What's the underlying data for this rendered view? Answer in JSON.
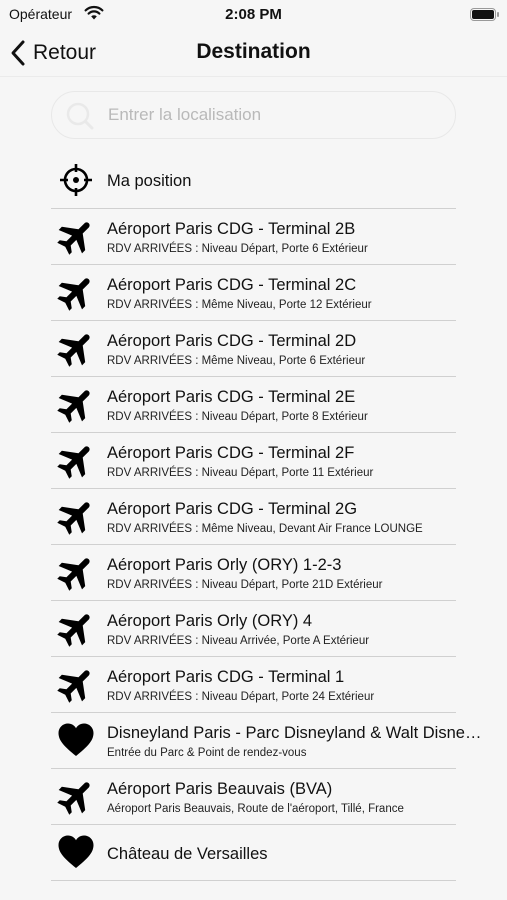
{
  "status_bar": {
    "carrier": "Opérateur",
    "time": "2:08 PM"
  },
  "nav": {
    "back_label": "Retour",
    "title": "Destination"
  },
  "search": {
    "placeholder": "Entrer la localisation"
  },
  "current_position": {
    "label": "Ma position",
    "icon": "crosshair-icon"
  },
  "destinations": [
    {
      "icon": "airplane-icon",
      "title": "Aéroport Paris CDG - Terminal 2B",
      "subtitle": "RDV ARRIVÉES : Niveau Départ, Porte 6 Extérieur"
    },
    {
      "icon": "airplane-icon",
      "title": "Aéroport Paris CDG - Terminal 2C",
      "subtitle": "RDV ARRIVÉES : Même Niveau, Porte 12 Extérieur"
    },
    {
      "icon": "airplane-icon",
      "title": "Aéroport Paris CDG - Terminal 2D",
      "subtitle": "RDV ARRIVÉES : Même Niveau, Porte 6 Extérieur"
    },
    {
      "icon": "airplane-icon",
      "title": "Aéroport Paris CDG - Terminal 2E",
      "subtitle": "RDV ARRIVÉES : Niveau Départ, Porte 8 Extérieur"
    },
    {
      "icon": "airplane-icon",
      "title": "Aéroport Paris CDG - Terminal 2F",
      "subtitle": "RDV ARRIVÉES : Niveau Départ, Porte 11 Extérieur"
    },
    {
      "icon": "airplane-icon",
      "title": "Aéroport Paris CDG - Terminal 2G",
      "subtitle": "RDV ARRIVÉES : Même Niveau, Devant Air France LOUNGE"
    },
    {
      "icon": "airplane-icon",
      "title": "Aéroport Paris Orly (ORY) 1-2-3",
      "subtitle": "RDV ARRIVÉES : Niveau Départ, Porte 21D Extérieur"
    },
    {
      "icon": "airplane-icon",
      "title": "Aéroport Paris Orly (ORY) 4",
      "subtitle": "RDV ARRIVÉES : Niveau Arrivée, Porte A Extérieur"
    },
    {
      "icon": "airplane-icon",
      "title": "Aéroport Paris CDG - Terminal  1",
      "subtitle": "RDV ARRIVÉES : Niveau Départ, Porte 24 Extérieur"
    },
    {
      "icon": "heart-icon",
      "title": "Disneyland Paris - Parc  Disneyland & Walt Disne…",
      "subtitle": "Entrée du Parc & Point de rendez-vous"
    },
    {
      "icon": "airplane-icon",
      "title": "Aéroport Paris Beauvais (BVA)",
      "subtitle": "Aéroport Paris Beauvais, Route de l'aéroport, Tillé, France"
    },
    {
      "icon": "heart-icon",
      "title": "Château de Versailles",
      "subtitle": ""
    }
  ]
}
